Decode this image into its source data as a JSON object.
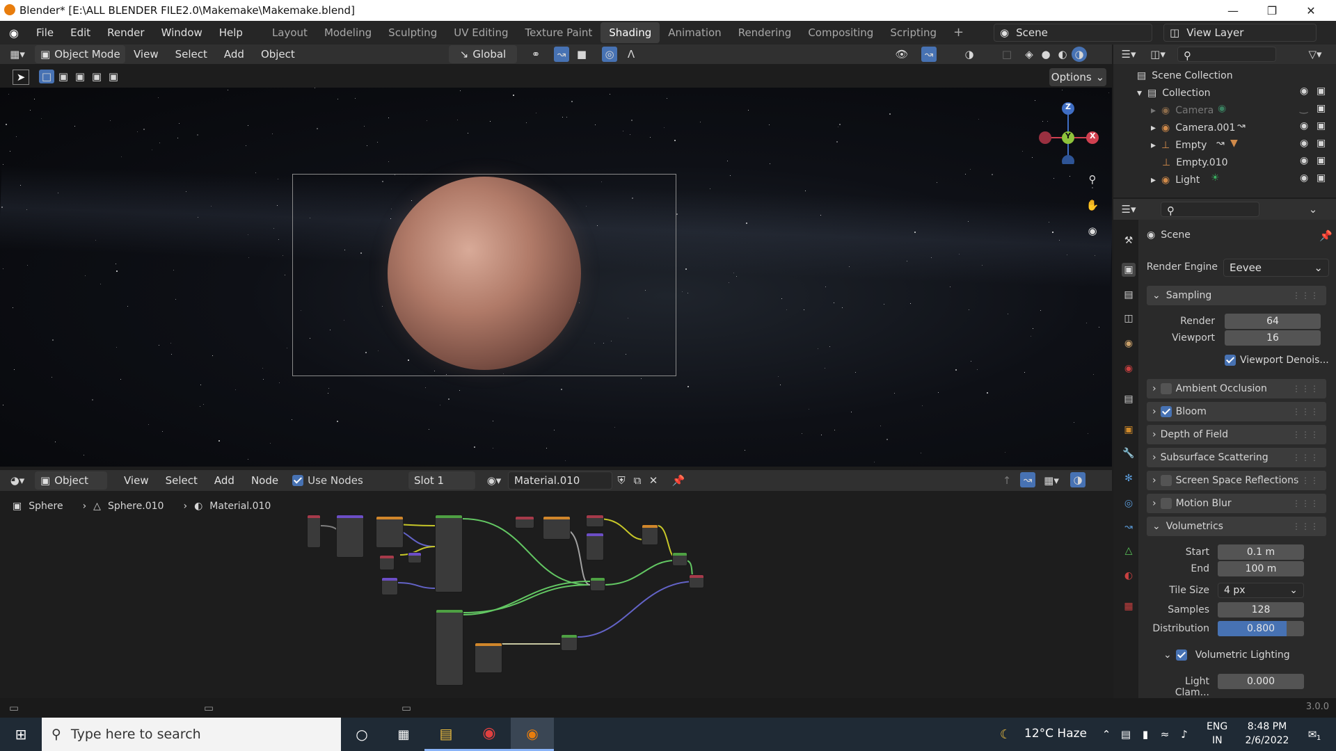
{
  "window": {
    "title": "Blender* [E:\\ALL BLENDER FILE2.0\\Makemake\\Makemake.blend]"
  },
  "menu": [
    "File",
    "Edit",
    "Render",
    "Window",
    "Help"
  ],
  "workspaces": [
    "Layout",
    "Modeling",
    "Sculpting",
    "UV Editing",
    "Texture Paint",
    "Shading",
    "Animation",
    "Rendering",
    "Compositing",
    "Scripting"
  ],
  "active_workspace": "Shading",
  "scene": {
    "name": "Scene",
    "view_layer": "View Layer"
  },
  "viewport_header": {
    "mode": "Object Mode",
    "menus": [
      "View",
      "Select",
      "Add",
      "Object"
    ],
    "orientation": "Global",
    "options_label": "Options"
  },
  "gizmo": {
    "z": "Z",
    "y": "Y",
    "x": "X"
  },
  "node_editor_header": {
    "editor": "Object",
    "menus": [
      "View",
      "Select",
      "Add",
      "Node"
    ],
    "use_nodes_label": "Use Nodes",
    "slot": "Slot 1",
    "material": "Material.010"
  },
  "breadcrumb": {
    "object": "Sphere",
    "mesh": "Sphere.010",
    "material": "Material.010"
  },
  "outliner": {
    "root": "Scene Collection",
    "collection": "Collection",
    "items": [
      "Camera",
      "Camera.001",
      "Empty",
      "Empty.010",
      "Light"
    ]
  },
  "properties": {
    "context": "Scene",
    "render_engine_label": "Render Engine",
    "render_engine": "Eevee",
    "sampling": {
      "label": "Sampling",
      "render_label": "Render",
      "render": "64",
      "viewport_label": "Viewport",
      "viewport": "16",
      "denoise_label": "Viewport Denois..."
    },
    "panels": [
      "Ambient Occlusion",
      "Bloom",
      "Depth of Field",
      "Subsurface Scattering",
      "Screen Space Reflections",
      "Motion Blur"
    ],
    "volumetrics": {
      "label": "Volumetrics",
      "start_label": "Start",
      "start": "0.1 m",
      "end_label": "End",
      "end": "100 m",
      "tile_label": "Tile Size",
      "tile": "4 px",
      "samples_label": "Samples",
      "samples": "128",
      "distribution_label": "Distribution",
      "distribution": "0.800",
      "distribution_fraction": 0.8,
      "lighting_label": "Volumetric Lighting",
      "clamp_label": "Light Clam...",
      "clamp": "0.000"
    }
  },
  "status": {
    "version": "3.0.0"
  },
  "taskbar": {
    "search_placeholder": "Type here to search",
    "weather": "12°C  Haze",
    "lang1": "ENG",
    "lang2": "IN",
    "time": "8:48 PM",
    "date": "2/6/2022",
    "notif": "1"
  },
  "colors": {
    "accent": "#4772b3",
    "active_ws": "#3d3d3d",
    "planet": "#b07a68"
  }
}
